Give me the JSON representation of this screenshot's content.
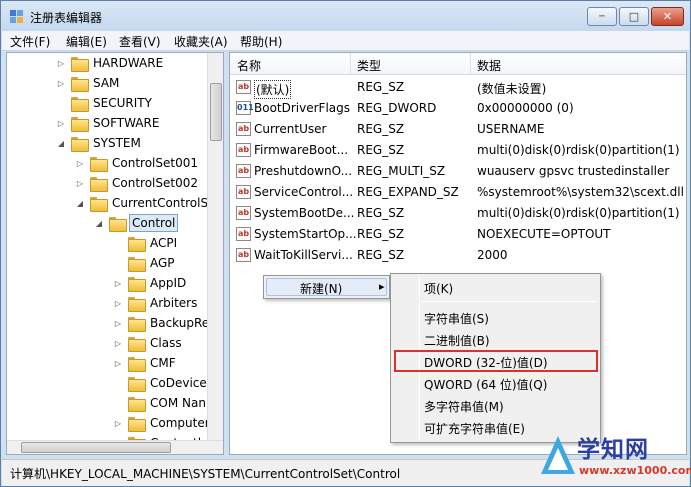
{
  "window": {
    "title": "注册表编辑器",
    "buttons": {
      "minimize": "─",
      "maximize": "□",
      "close": "✕"
    }
  },
  "menu": [
    "文件(F)",
    "编辑(E)",
    "查看(V)",
    "收藏夹(A)",
    "帮助(H)"
  ],
  "tree": [
    {
      "label": "HARDWARE",
      "toggle": "▷"
    },
    {
      "label": "SAM",
      "toggle": "▷"
    },
    {
      "label": "SECURITY",
      "toggle": ""
    },
    {
      "label": "SOFTWARE",
      "toggle": "▷"
    },
    {
      "label": "SYSTEM",
      "toggle": "◢"
    },
    {
      "label": "ControlSet001",
      "toggle": "▷"
    },
    {
      "label": "ControlSet002",
      "toggle": "▷"
    },
    {
      "label": "CurrentControlSe",
      "toggle": "◢"
    },
    {
      "label": "Control",
      "toggle": "◢"
    },
    {
      "label": "ACPI",
      "toggle": ""
    },
    {
      "label": "AGP",
      "toggle": ""
    },
    {
      "label": "AppID",
      "toggle": "▷"
    },
    {
      "label": "Arbiters",
      "toggle": "▷"
    },
    {
      "label": "BackupRe",
      "toggle": "▷"
    },
    {
      "label": "Class",
      "toggle": "▷"
    },
    {
      "label": "CMF",
      "toggle": "▷"
    },
    {
      "label": "CoDeviceI",
      "toggle": ""
    },
    {
      "label": "COM Nan",
      "toggle": ""
    },
    {
      "label": "Computer",
      "toggle": "▷"
    },
    {
      "label": "Contentl",
      "toggle": ""
    }
  ],
  "list": {
    "columns": [
      "名称",
      "类型",
      "数据"
    ],
    "rows": [
      {
        "icon": "ab",
        "kind": "sz",
        "name": "(默认)",
        "type": "REG_SZ",
        "data": "(数值未设置)"
      },
      {
        "icon": "011",
        "kind": "bin",
        "name": "BootDriverFlags",
        "type": "REG_DWORD",
        "data": "0x00000000 (0)"
      },
      {
        "icon": "ab",
        "kind": "sz",
        "name": "CurrentUser",
        "type": "REG_SZ",
        "data": "USERNAME"
      },
      {
        "icon": "ab",
        "kind": "sz",
        "name": "FirmwareBoot...",
        "type": "REG_SZ",
        "data": "multi(0)disk(0)rdisk(0)partition(1)"
      },
      {
        "icon": "ab",
        "kind": "sz",
        "name": "PreshutdownO...",
        "type": "REG_MULTI_SZ",
        "data": "wuauserv gpsvc trustedinstaller"
      },
      {
        "icon": "ab",
        "kind": "sz",
        "name": "ServiceControl...",
        "type": "REG_EXPAND_SZ",
        "data": "%systemroot%\\system32\\scext.dll"
      },
      {
        "icon": "ab",
        "kind": "sz",
        "name": "SystemBootDe...",
        "type": "REG_SZ",
        "data": "multi(0)disk(0)rdisk(0)partition(1)"
      },
      {
        "icon": "ab",
        "kind": "sz",
        "name": "SystemStartOp...",
        "type": "REG_SZ",
        "data": " NOEXECUTE=OPTOUT"
      },
      {
        "icon": "ab",
        "kind": "sz",
        "name": "WaitToKillServi...",
        "type": "REG_SZ",
        "data": "2000"
      }
    ]
  },
  "context_menu": {
    "parent": {
      "label": "新建(N)",
      "arrow": "▸"
    },
    "items": [
      "项(K)",
      "字符串值(S)",
      "二进制值(B)",
      "DWORD (32-位)值(D)",
      "QWORD (64 位)值(Q)",
      "多字符串值(M)",
      "可扩充字符串值(E)"
    ],
    "highlighted": "DWORD (32-位)值(D)"
  },
  "status": "计算机\\HKEY_LOCAL_MACHINE\\SYSTEM\\CurrentControlSet\\Control",
  "watermark": {
    "title": "学知网",
    "url": "www.xzw1000.com"
  },
  "colors": {
    "highlight_border": "#d9312b",
    "selection": "#dce9f7"
  }
}
